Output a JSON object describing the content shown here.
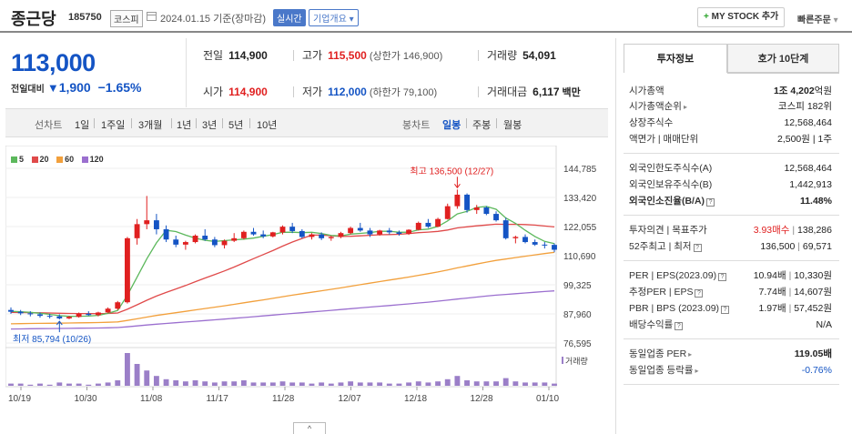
{
  "header": {
    "name": "종근당",
    "code": "185750",
    "market": "코스피",
    "date": "2024.01.15 기준(장마감)",
    "realtime": "실시간",
    "corp": "기업개요",
    "mystock": "MY STOCK 추가",
    "mystock_plus": "+",
    "quick": "빠른주문"
  },
  "quote": {
    "price": "113,000",
    "change_label": "전일대비",
    "change_arrow": "▼",
    "change": "1,900",
    "change_pct": "−1.65%"
  },
  "stats": {
    "prev_label": "전일",
    "prev": "114,900",
    "high_label": "고가",
    "high": "115,500",
    "high_sub": "(상한가 146,900)",
    "vol_label": "거래량",
    "vol": "54,091",
    "open_label": "시가",
    "open": "114,900",
    "low_label": "저가",
    "low": "112,000",
    "low_sub": "(하한가 79,100)",
    "amt_label": "거래대금",
    "amt": "6,117",
    "amt_unit": "백만"
  },
  "periods": {
    "line_label": "선차트",
    "line_items": [
      "1일",
      "1주일",
      "3개월",
      "1년",
      "3년",
      "5년",
      "10년"
    ],
    "candle_label": "봉차트",
    "candle_items": [
      "일봉",
      "주봉",
      "월봉"
    ],
    "candle_active": "일봉"
  },
  "legend": [
    "5",
    "20",
    "60",
    "120"
  ],
  "colors": {
    "ma5": "#5cb85c",
    "ma20": "#e04a4a",
    "ma60": "#f2a03c",
    "ma120": "#9b6fcf",
    "up": "#e02020",
    "down": "#1454c4",
    "volume": "#9b7fc8"
  },
  "chart_data": {
    "type": "candlestick",
    "y_ticks": [
      "144,785",
      "133,420",
      "122,055",
      "110,690",
      "99,325",
      "87,960",
      "76,595"
    ],
    "x_ticks": [
      "10/19",
      "10/30",
      "11/08",
      "11/17",
      "11/28",
      "12/07",
      "12/18",
      "12/28",
      "01/10"
    ],
    "max_label": "최고 136,500 (12/27)",
    "min_label": "최저 85,794 (10/26)",
    "volume_label": "거래량",
    "ylim": [
      76595,
      144785
    ],
    "candles": [
      [
        89500,
        90500,
        88000,
        88800
      ],
      [
        88800,
        89500,
        87500,
        88200
      ],
      [
        88200,
        89000,
        87000,
        87800
      ],
      [
        87800,
        88500,
        86500,
        87200
      ],
      [
        87200,
        88000,
        86200,
        87000
      ],
      [
        87000,
        87800,
        85794,
        86200
      ],
      [
        86200,
        87200,
        85900,
        86800
      ],
      [
        86800,
        88500,
        86500,
        88000
      ],
      [
        88000,
        89000,
        87200,
        87500
      ],
      [
        87500,
        88800,
        87000,
        88500
      ],
      [
        88500,
        90500,
        88200,
        90000
      ],
      [
        90000,
        93000,
        89500,
        92500
      ],
      [
        92500,
        118000,
        92000,
        117500
      ],
      [
        117500,
        125000,
        115000,
        123000
      ],
      [
        123000,
        134000,
        121000,
        124500
      ],
      [
        124500,
        127000,
        119000,
        121000
      ],
      [
        121000,
        122500,
        116000,
        117000
      ],
      [
        117000,
        118500,
        114000,
        115000
      ],
      [
        115000,
        116500,
        113000,
        116000
      ],
      [
        116000,
        119000,
        115500,
        118500
      ],
      [
        118500,
        121000,
        116500,
        117000
      ],
      [
        117000,
        118000,
        114000,
        114800
      ],
      [
        114800,
        117000,
        113500,
        116500
      ],
      [
        116500,
        119500,
        116000,
        117500
      ],
      [
        117500,
        120500,
        117000,
        120000
      ],
      [
        120000,
        121500,
        118500,
        119000
      ],
      [
        119000,
        120500,
        117500,
        118200
      ],
      [
        118200,
        120000,
        117800,
        119800
      ],
      [
        119800,
        122500,
        119000,
        122000
      ],
      [
        122000,
        123500,
        119500,
        120300
      ],
      [
        120300,
        121000,
        117500,
        118000
      ],
      [
        118000,
        119500,
        117000,
        119000
      ],
      [
        119000,
        119800,
        116800,
        117500
      ],
      [
        117500,
        118500,
        116500,
        118000
      ],
      [
        118000,
        120000,
        117500,
        119500
      ],
      [
        119500,
        122000,
        119000,
        121500
      ],
      [
        121500,
        123500,
        120000,
        120500
      ],
      [
        120500,
        121500,
        118000,
        119000
      ],
      [
        119000,
        120800,
        118500,
        120500
      ],
      [
        120500,
        121500,
        119000,
        119800
      ],
      [
        119800,
        120500,
        118500,
        119200
      ],
      [
        119200,
        121000,
        118800,
        120800
      ],
      [
        120800,
        124000,
        120500,
        123500
      ],
      [
        123500,
        125000,
        121500,
        122000
      ],
      [
        122000,
        125500,
        121800,
        125000
      ],
      [
        125000,
        131000,
        124800,
        130000
      ],
      [
        130000,
        136500,
        129000,
        134500
      ],
      [
        134500,
        135000,
        127500,
        128500
      ],
      [
        128500,
        130500,
        127000,
        129500
      ],
      [
        129500,
        130000,
        126500,
        127000
      ],
      [
        127000,
        128000,
        124000,
        124500
      ],
      [
        124500,
        125500,
        117000,
        117500
      ],
      [
        117500,
        118500,
        115500,
        118000
      ],
      [
        118000,
        119000,
        115500,
        116000
      ],
      [
        116000,
        117000,
        114500,
        115000
      ],
      [
        115000,
        116000,
        113500,
        114900
      ],
      [
        114900,
        115500,
        112000,
        113000
      ]
    ],
    "volumes": [
      2,
      2,
      1,
      2,
      1,
      3,
      2,
      2,
      1,
      2,
      3,
      5,
      30,
      20,
      14,
      9,
      6,
      5,
      4,
      5,
      4,
      3,
      4,
      4,
      5,
      3,
      3,
      3,
      4,
      3,
      3,
      2,
      3,
      2,
      3,
      4,
      3,
      3,
      3,
      2,
      2,
      3,
      4,
      3,
      4,
      6,
      9,
      5,
      4,
      4,
      4,
      7,
      4,
      3,
      3,
      3,
      2
    ]
  },
  "tabs": {
    "active": "투자정보",
    "inactive": "호가 10단계"
  },
  "info": {
    "mcap_label": "시가총액",
    "mcap_a": "1조",
    "mcap_b": "4,202",
    "mcap_unit": "억원",
    "rank_label": "시가총액순위",
    "rank": "코스피 182위",
    "shares_label": "상장주식수",
    "shares": "12,568,464",
    "par_label": "액면가 | 매매단위",
    "par": "2,500원 | 1주",
    "f_limit_label": "외국인한도주식수(A)",
    "f_limit": "12,568,464",
    "f_hold_label": "외국인보유주식수(B)",
    "f_hold": "1,442,913",
    "f_ratio_label": "외국인소진율(B/A)",
    "f_ratio": "11.48%",
    "opinion_label": "투자의견 | 목표주가",
    "opinion": "3.93매수",
    "target": "138,286",
    "w52_label": "52주최고 | 최저",
    "w52_high": "136,500",
    "w52_low": "69,571",
    "per_label": "PER | EPS(2023.09)",
    "per": "10.94배",
    "eps": "10,330원",
    "eper_label": "추정PER | EPS",
    "eper": "7.74배",
    "eeps": "14,607원",
    "pbr_label": "PBR | BPS (2023.09)",
    "pbr": "1.97배",
    "bps": "57,452원",
    "div_label": "배당수익률",
    "div": "N/A",
    "ind_per_label": "동일업종 PER",
    "ind_per": "119.05배",
    "ind_rate_label": "동일업종 등락률",
    "ind_rate": "-0.76%"
  },
  "collapse_icon": "^"
}
